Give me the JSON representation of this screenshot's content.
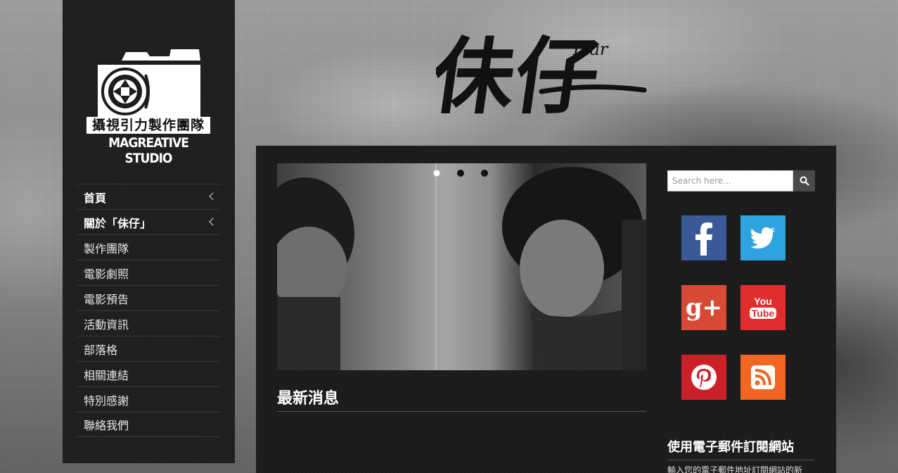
{
  "logo": {
    "cn_text": "攝視引力製作團隊",
    "en_text": "MAGREATIVE STUDIO"
  },
  "header": {
    "title_cn": "佅仔",
    "title_en": "Liar"
  },
  "nav": {
    "items": [
      {
        "label": "首頁",
        "has_submenu": true,
        "active": true
      },
      {
        "label": "關於「佅仔」",
        "has_submenu": true,
        "active": true
      },
      {
        "label": "製作團隊",
        "has_submenu": false
      },
      {
        "label": "電影劇照",
        "has_submenu": false
      },
      {
        "label": "電影預告",
        "has_submenu": false
      },
      {
        "label": "活動資訊",
        "has_submenu": false
      },
      {
        "label": "部落格",
        "has_submenu": false
      },
      {
        "label": "相關連結",
        "has_submenu": false
      },
      {
        "label": "特別感謝",
        "has_submenu": false
      },
      {
        "label": "聯絡我們",
        "has_submenu": false
      }
    ]
  },
  "slider": {
    "slide_count": 3,
    "active_slide": 1
  },
  "main": {
    "news_heading": "最新消息"
  },
  "search": {
    "placeholder": "Search here..."
  },
  "social": {
    "icons": [
      "facebook-icon",
      "twitter-icon",
      "google-plus-icon",
      "youtube-icon",
      "pinterest-icon",
      "rss-icon"
    ],
    "youtube_you": "You",
    "youtube_tube": "Tube",
    "googleplus_text": "g+"
  },
  "subscribe": {
    "heading": "使用電子郵件訂閱網站",
    "text": "輸入您的電子郵件地址訂閱網站的新"
  },
  "colors": {
    "facebook": "#3b5998",
    "twitter": "#2fa3e0",
    "googleplus": "#d74b36",
    "youtube": "#e02d2d",
    "pinterest": "#cb2027",
    "rss": "#f26522"
  }
}
